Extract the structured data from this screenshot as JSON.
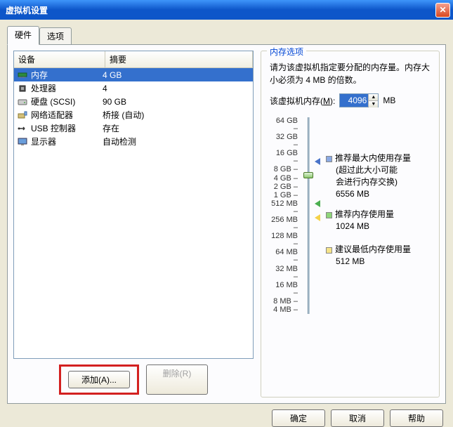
{
  "window": {
    "title": "虚拟机设置"
  },
  "tabs": [
    {
      "label": "硬件",
      "active": true
    },
    {
      "label": "选项",
      "active": false
    }
  ],
  "hw_table": {
    "col_device": "设备",
    "col_summary": "摘要",
    "rows": [
      {
        "name": "内存",
        "summary": "4 GB",
        "icon": "memory",
        "selected": true
      },
      {
        "name": "处理器",
        "summary": "4",
        "icon": "cpu"
      },
      {
        "name": "硬盘 (SCSI)",
        "summary": "90 GB",
        "icon": "disk"
      },
      {
        "name": "网络适配器",
        "summary": "桥接 (自动)",
        "icon": "network"
      },
      {
        "name": "USB 控制器",
        "summary": "存在",
        "icon": "usb"
      },
      {
        "name": "显示器",
        "summary": "自动检测",
        "icon": "display"
      }
    ]
  },
  "buttons": {
    "add": "添加(A)...",
    "remove": "删除(R)",
    "ok": "确定",
    "cancel": "取消",
    "help": "帮助"
  },
  "memory_panel": {
    "title": "内存选项",
    "desc": "请为该虚拟机指定要分配的内存量。内存大小必须为 4 MB 的倍数。",
    "label_pre": "该虚拟机内存(",
    "label_u": "M",
    "label_post": "):",
    "value": "4096",
    "unit": "MB",
    "ticks": [
      "64 GB",
      "32 GB",
      "16 GB",
      "8 GB",
      "4 GB",
      "2 GB",
      "1 GB",
      "512 MB",
      "256 MB",
      "128 MB",
      "64 MB",
      "32 MB",
      "16 MB",
      "8 MB",
      "4 MB"
    ],
    "rec_max_title": "推荐最大内使用存量",
    "rec_max_note1": "(超过此大小可能",
    "rec_max_note2": "会进行内存交换)",
    "rec_max_val": "6556 MB",
    "rec_title": "推荐内存使用量",
    "rec_val": "1024 MB",
    "min_title": "建议最低内存使用量",
    "min_val": "512 MB"
  }
}
